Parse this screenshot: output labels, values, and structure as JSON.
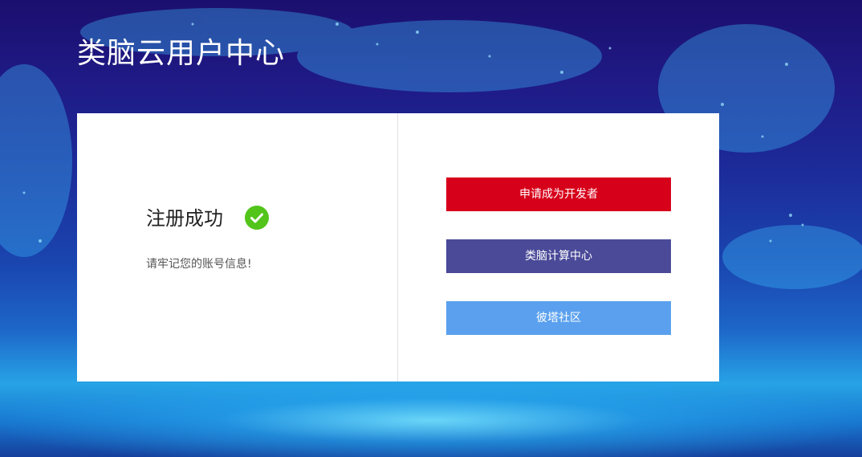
{
  "header": {
    "title": "类脑云用户中心"
  },
  "card": {
    "success_title": "注册成功",
    "success_icon": "check-circle-icon",
    "success_color": "#52c41a",
    "message": "请牢记您的账号信息!",
    "buttons": [
      {
        "label": "申请成为开发者",
        "color": "#d7001b"
      },
      {
        "label": "类脑计算中心",
        "color": "#4a4a99"
      },
      {
        "label": "彼塔社区",
        "color": "#5aa0ee"
      }
    ]
  }
}
